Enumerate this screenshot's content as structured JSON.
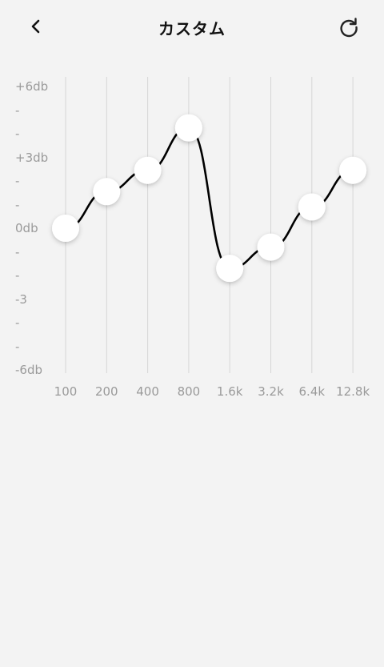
{
  "header": {
    "title": "カスタム",
    "back_icon": "chevron-left-icon",
    "reset_icon": "refresh-icon"
  },
  "equalizer": {
    "y_ticks": [
      "+6db",
      "-",
      "-",
      "+3db",
      "-",
      "-",
      "0db",
      "-",
      "-",
      "-3",
      "-",
      "-",
      "-6db"
    ],
    "y_range_db": [
      -6,
      6
    ],
    "bands": [
      {
        "label": "100",
        "gain_db": 0
      },
      {
        "label": "200",
        "gain_db": 1.55
      },
      {
        "label": "400",
        "gain_db": 2.45
      },
      {
        "label": "800",
        "gain_db": 4.25
      },
      {
        "label": "1.6k",
        "gain_db": -1.7
      },
      {
        "label": "3.2k",
        "gain_db": -0.8
      },
      {
        "label": "6.4k",
        "gain_db": 0.9
      },
      {
        "label": "12.8k",
        "gain_db": 2.45
      }
    ],
    "colors": {
      "curve": "#000000",
      "grid": "#d6d6d6",
      "knob": "#ffffff"
    }
  }
}
